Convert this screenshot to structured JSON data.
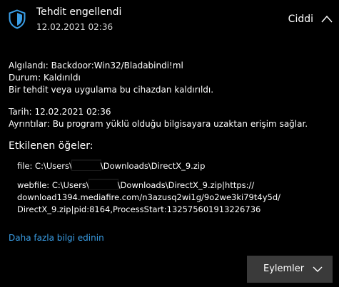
{
  "notification": {
    "title": "Tehdit engellendi",
    "timestamp": "12.02.2021 02:36",
    "severity": "Ciddi",
    "icon": "shield-icon",
    "accent_color": "#3a9ee6"
  },
  "details": {
    "detected_label": "Algılandı:",
    "detected_value": "Backdoor:Win32/Bladabindi!ml",
    "status_label": "Durum:",
    "status_value": "Kaldırıldı",
    "status_description": "Bir tehdit veya uygulama bu cihazdan kaldırıldı.",
    "date_label": "Tarih:",
    "date_value": "12.02.2021 02:36",
    "info_label": "Ayrıntılar:",
    "info_value": "Bu program yüklü olduğu bilgisayara uzaktan erişim sağlar."
  },
  "affected": {
    "heading": "Etkilenen öğeler:",
    "file_prefix": "file: C:\\Users\\",
    "file_suffix": "\\Downloads\\DirectX_9.zip",
    "webfile_prefix": "webfile: C:\\Users\\",
    "webfile_suffix": "\\Downloads\\DirectX_9.zip|https://",
    "webfile_line2": "download1394.mediafire.com/n3azusq2wi1g/9o2we3ki79t4y5d/",
    "webfile_line3": "DirectX_9.zip|pid:8164,ProcessStart:132575601913226736"
  },
  "link_label": "Daha fazla bilgi edinin",
  "actions_label": "Eylemler"
}
